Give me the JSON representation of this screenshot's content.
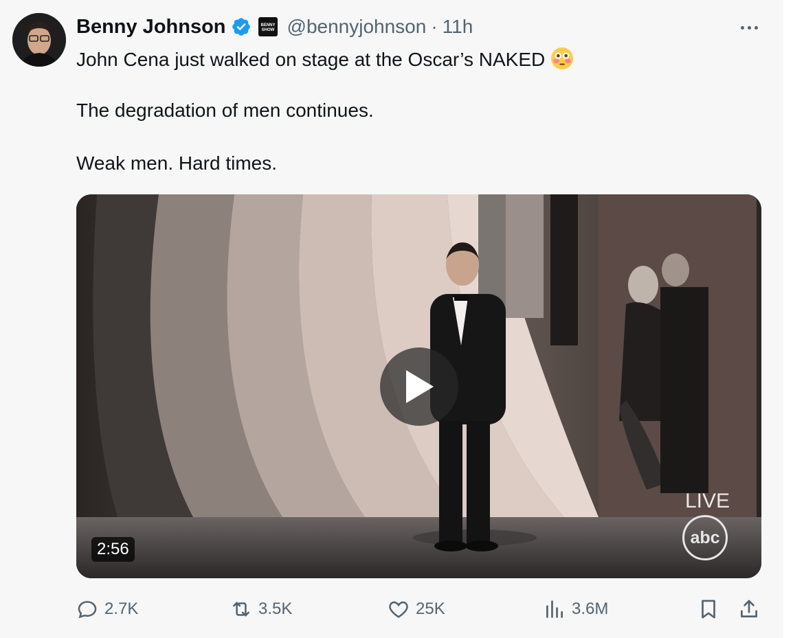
{
  "author": {
    "name": "Benny Johnson",
    "handle": "@bennyjohnson",
    "separator": "·",
    "time": "11h",
    "affiliate_badge": "BENNY SHOW"
  },
  "tweet": {
    "line1": "John Cena just walked on stage at the Oscar’s NAKED",
    "line2": "The degradation of men continues.",
    "line3": "Weak men. Hard times."
  },
  "media": {
    "duration": "2:56",
    "live_label": "LIVE",
    "network_logo": "abc"
  },
  "actions": {
    "replies": "2.7K",
    "reposts": "3.5K",
    "likes": "25K",
    "views": "3.6M"
  },
  "icons": {
    "more": "more-options-icon",
    "verified": "verified-badge-icon",
    "emoji": "flushed-face-icon",
    "play": "play-icon",
    "reply": "reply-icon",
    "repost": "repost-icon",
    "like": "heart-icon",
    "views": "analytics-icon",
    "bookmark": "bookmark-icon",
    "share": "share-icon"
  },
  "colors": {
    "verified": "#1d9bf0",
    "muted_text": "#536471",
    "text": "#0f1419"
  }
}
